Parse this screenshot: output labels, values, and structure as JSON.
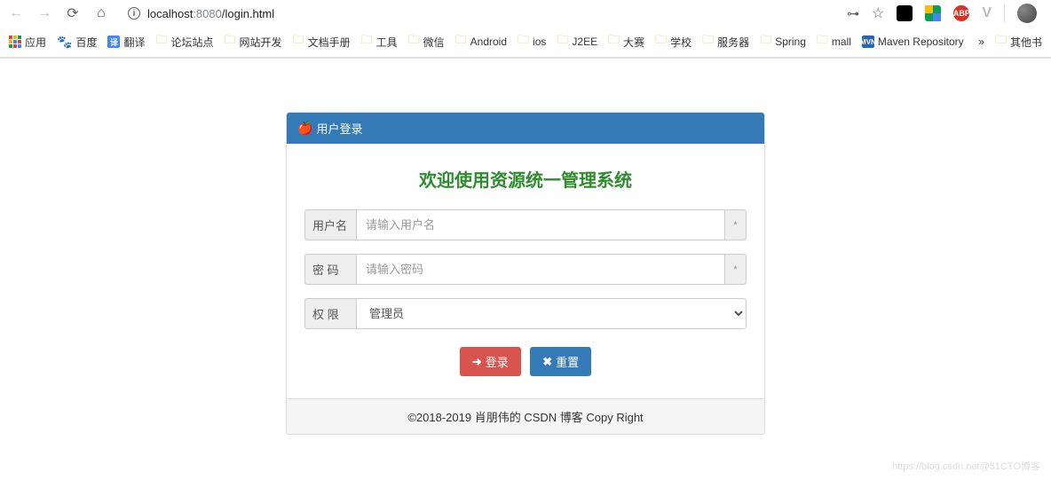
{
  "browser": {
    "url_host": "localhost",
    "url_port": ":8080",
    "url_path": "/login.html",
    "ext_abp": "ABP",
    "ext_vue": "V"
  },
  "bookmarks": {
    "apps": "应用",
    "baidu": "百度",
    "translate": "翻译",
    "forum": "论坛站点",
    "webdev": "网站开发",
    "docs": "文档手册",
    "tools": "工具",
    "wechat": "微信",
    "android": "Android",
    "ios": "ios",
    "j2ee": "J2EE",
    "contest": "大赛",
    "school": "学校",
    "server": "服务器",
    "spring": "Spring",
    "mall": "mall",
    "maven": "Maven Repository",
    "more": "»",
    "otherbooks": "其他书"
  },
  "login": {
    "header": "用户登录",
    "welcome": "欢迎使用资源统一管理系统",
    "username_label": "用户名",
    "username_placeholder": "请输入用户名",
    "password_label": "密  码",
    "password_placeholder": "请输入密码",
    "role_label": "权  限",
    "role_selected": "管理员",
    "required_mark": "*",
    "login_btn": "登录",
    "reset_btn": "重置",
    "footer": "©2018-2019 肖朋伟的 CSDN 博客 Copy Right"
  },
  "watermark": "https://blog.csdn.net@51CTO博客"
}
